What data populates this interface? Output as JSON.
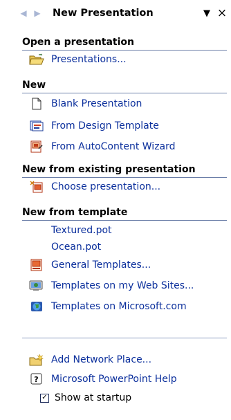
{
  "pane": {
    "title": "New Presentation",
    "back_icon": "back-arrow-icon",
    "forward_icon": "forward-arrow-icon",
    "menu_icon": "dropdown-triangle-icon",
    "close_icon": "close-icon",
    "menu_glyph": "▼",
    "close_glyph": "×"
  },
  "sections": {
    "open": {
      "title": "Open a presentation",
      "items": [
        {
          "label": "Presentations...",
          "icon": "open-folder-icon"
        }
      ]
    },
    "new": {
      "title": "New",
      "items": [
        {
          "label": "Blank Presentation",
          "icon": "blank-page-icon"
        },
        {
          "label": "From Design Template",
          "icon": "design-template-icon"
        },
        {
          "label": "From AutoContent Wizard",
          "icon": "autocontent-wizard-icon"
        }
      ]
    },
    "existing": {
      "title": "New from existing presentation",
      "items": [
        {
          "label": "Choose presentation...",
          "icon": "choose-presentation-icon"
        }
      ]
    },
    "template": {
      "title": "New from template",
      "items": [
        {
          "label": "Textured.pot"
        },
        {
          "label": "Ocean.pot"
        },
        {
          "label": "General Templates...",
          "icon": "general-templates-icon"
        },
        {
          "label": "Templates on my Web Sites...",
          "icon": "web-sites-icon"
        },
        {
          "label": "Templates on Microsoft.com",
          "icon": "globe-icon"
        }
      ]
    }
  },
  "footer": {
    "network": {
      "label": "Add Network Place...",
      "icon": "network-place-icon"
    },
    "help": {
      "label": "Microsoft PowerPoint Help",
      "icon": "help-icon"
    },
    "startup": {
      "label": "Show at startup",
      "checked": true
    }
  },
  "colors": {
    "link": "#0b2f9c",
    "divider": "#6b7ea8",
    "header_text": "#000000"
  }
}
